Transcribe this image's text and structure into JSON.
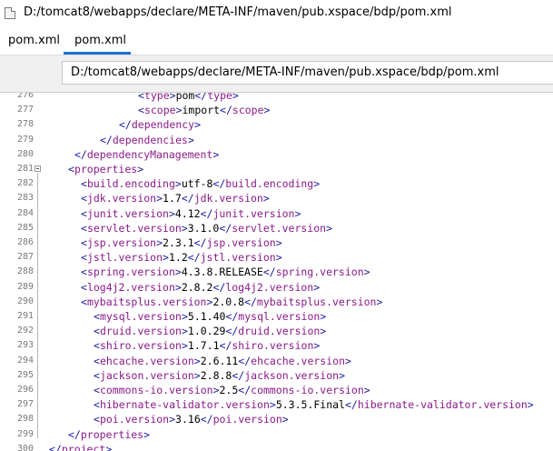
{
  "window": {
    "title": "D:/tomcat8/webapps/declare/META-INF/maven/pub.xspace/bdp/pom.xml",
    "app_icon": "file-icon"
  },
  "tabs": [
    {
      "label": "pom.xml",
      "active": false
    },
    {
      "label": "pom.xml",
      "active": true
    }
  ],
  "path_field": {
    "value": "D:/tomcat8/webapps/declare/META-INF/maven/pub.xspace/bdp/pom.xml"
  },
  "colors": {
    "tag": "#8a1a8a",
    "bracket": "#1a1aa6",
    "text": "#000000",
    "active_tab": "#1e6fd9"
  },
  "code_lines": [
    {
      "n": "276",
      "indent": 14,
      "tag": "type",
      "value": "pom",
      "partial": true
    },
    {
      "n": "277",
      "indent": 14,
      "tag": "scope",
      "value": "import"
    },
    {
      "n": "278",
      "indent": 11,
      "close": "dependency"
    },
    {
      "n": "279",
      "indent": 8,
      "close": "dependencies"
    },
    {
      "n": "280",
      "indent": 4,
      "close": "dependencyManagement"
    },
    {
      "n": "281",
      "indent": 3,
      "open": "properties",
      "fold": true
    },
    {
      "n": "282",
      "indent": 5,
      "tag": "build.encoding",
      "value": "utf-8"
    },
    {
      "n": "283",
      "indent": 5,
      "tag": "jdk.version",
      "value": "1.7"
    },
    {
      "n": "284",
      "indent": 5,
      "tag": "junit.version",
      "value": "4.12"
    },
    {
      "n": "285",
      "indent": 5,
      "tag": "servlet.version",
      "value": "3.1.0"
    },
    {
      "n": "286",
      "indent": 5,
      "tag": "jsp.version",
      "value": "2.3.1"
    },
    {
      "n": "287",
      "indent": 5,
      "tag": "jstl.version",
      "value": "1.2"
    },
    {
      "n": "288",
      "indent": 5,
      "tag": "spring.version",
      "value": "4.3.8.RELEASE"
    },
    {
      "n": "289",
      "indent": 5,
      "tag": "log4j2.version",
      "value": "2.8.2"
    },
    {
      "n": "290",
      "indent": 5,
      "tag": "mybaitsplus.version",
      "value": "2.0.8"
    },
    {
      "n": "291",
      "indent": 7,
      "tag": "mysql.version",
      "value": "5.1.40"
    },
    {
      "n": "292",
      "indent": 7,
      "tag": "druid.version",
      "value": "1.0.29"
    },
    {
      "n": "293",
      "indent": 7,
      "tag": "shiro.version",
      "value": "1.7.1"
    },
    {
      "n": "294",
      "indent": 7,
      "tag": "ehcache.version",
      "value": "2.6.11"
    },
    {
      "n": "295",
      "indent": 7,
      "tag": "jackson.version",
      "value": "2.8.8"
    },
    {
      "n": "296",
      "indent": 7,
      "tag": "commons-io.version",
      "value": "2.5"
    },
    {
      "n": "297",
      "indent": 7,
      "tag": "hibernate-validator.version",
      "value": "5.3.5.Final"
    },
    {
      "n": "298",
      "indent": 7,
      "tag": "poi.version",
      "value": "3.16"
    },
    {
      "n": "299",
      "indent": 3,
      "close": "properties"
    },
    {
      "n": "300",
      "indent": 0,
      "close": "project"
    }
  ]
}
